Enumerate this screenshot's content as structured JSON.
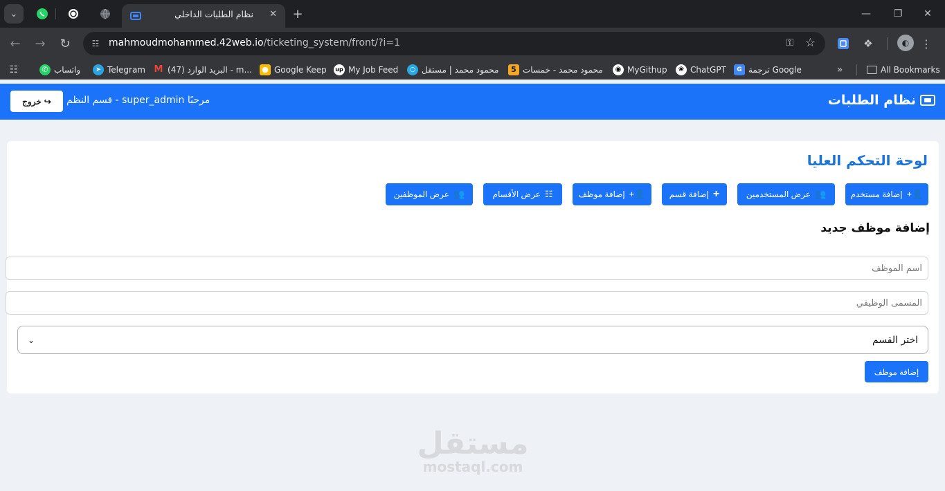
{
  "browser": {
    "active_tab_title": "نظام الطلبات الداخلي",
    "url_host": "mahmoudmohammed.42web.io",
    "url_path": "/ticketing_system/front/?i=1",
    "bookmarks": [
      {
        "label": "واتساب",
        "icon": "whatsapp-icon"
      },
      {
        "label": "Telegram",
        "icon": "telegram-icon"
      },
      {
        "label": "البريد الوارد (47) - m...",
        "icon": "gmail-icon"
      },
      {
        "label": "Google Keep",
        "icon": "keep-icon"
      },
      {
        "label": "My Job Feed",
        "icon": "upwork-icon"
      },
      {
        "label": "محمود محمد | مستقل",
        "icon": "mostaql-icon"
      },
      {
        "label": "محمود محمد - خمسات",
        "icon": "khamsat-icon"
      },
      {
        "label": "MyGithup",
        "icon": "github-icon"
      },
      {
        "label": "ChatGPT",
        "icon": "chatgpt-icon"
      },
      {
        "label": "ترجمة Google",
        "icon": "translate-icon"
      }
    ],
    "all_bookmarks_label": "All Bookmarks",
    "khamsat_badge": "5"
  },
  "header": {
    "brand": "نظام الطلبات",
    "welcome": "مرحبًا super_admin - قسم النظم",
    "logout_label": "خروج"
  },
  "dashboard": {
    "title": "لوحة التحكم العليا",
    "actions": [
      {
        "label": "إضافة مستخدم",
        "icon": "user-plus-icon"
      },
      {
        "label": "عرض المستخدمين",
        "icon": "users-icon"
      },
      {
        "label": "إضافة قسم",
        "icon": "plus-icon"
      },
      {
        "label": "إضافة موظف",
        "icon": "user-plus-icon"
      },
      {
        "label": "عرض الأقسام",
        "icon": "sitemap-icon"
      },
      {
        "label": "عرض الموظفين",
        "icon": "users-icon"
      }
    ]
  },
  "form": {
    "title": "إضافة موظف جديد",
    "name_placeholder": "اسم الموظف",
    "job_title_placeholder": "المسمى الوظيفي",
    "department_select": "اختر القسم",
    "submit_label": "إضافة موظف"
  },
  "watermark": {
    "line1": "مستقل",
    "line2": "mostaql.com"
  },
  "colors": {
    "primary": "#1a73f8",
    "title_blue": "#1a73d9",
    "page_bg": "#eef1f5"
  }
}
